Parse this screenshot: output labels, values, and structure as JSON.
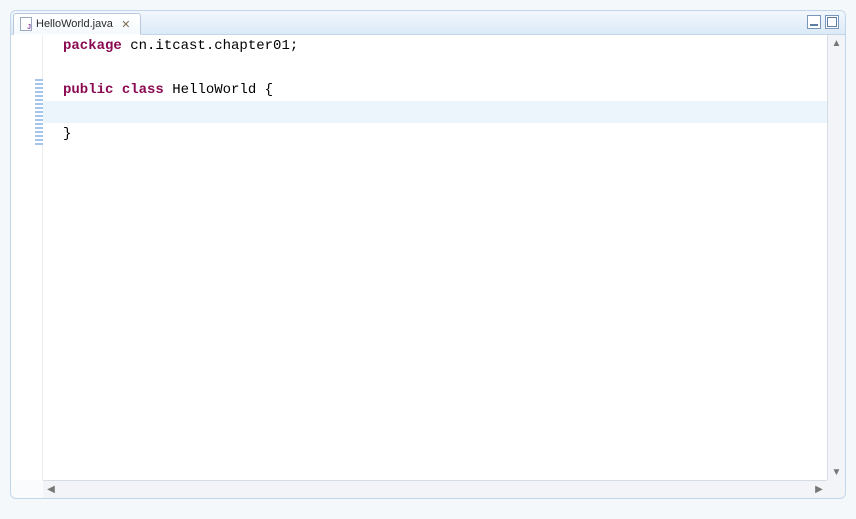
{
  "tab": {
    "filename": "HelloWorld.java",
    "close_glyph": "✕"
  },
  "controls": {
    "minimize": "_",
    "maximize": "□"
  },
  "code": {
    "lines": [
      {
        "kw": "package",
        "rest": " cn.itcast.chapter01;",
        "hl": false
      },
      {
        "kw": "",
        "rest": "",
        "hl": false
      },
      {
        "kw": "public",
        "rest": " ",
        "kw2": "class",
        "rest2": " HelloWorld {",
        "hl": false
      },
      {
        "kw": "",
        "rest": "\t",
        "hl": true
      },
      {
        "kw": "",
        "rest": "}",
        "hl": false
      }
    ]
  },
  "gutter_marks": [
    {
      "line": 2,
      "span": 3
    }
  ],
  "scroll": {
    "up": "▲",
    "down": "▼",
    "left": "◀",
    "right": "▶"
  }
}
